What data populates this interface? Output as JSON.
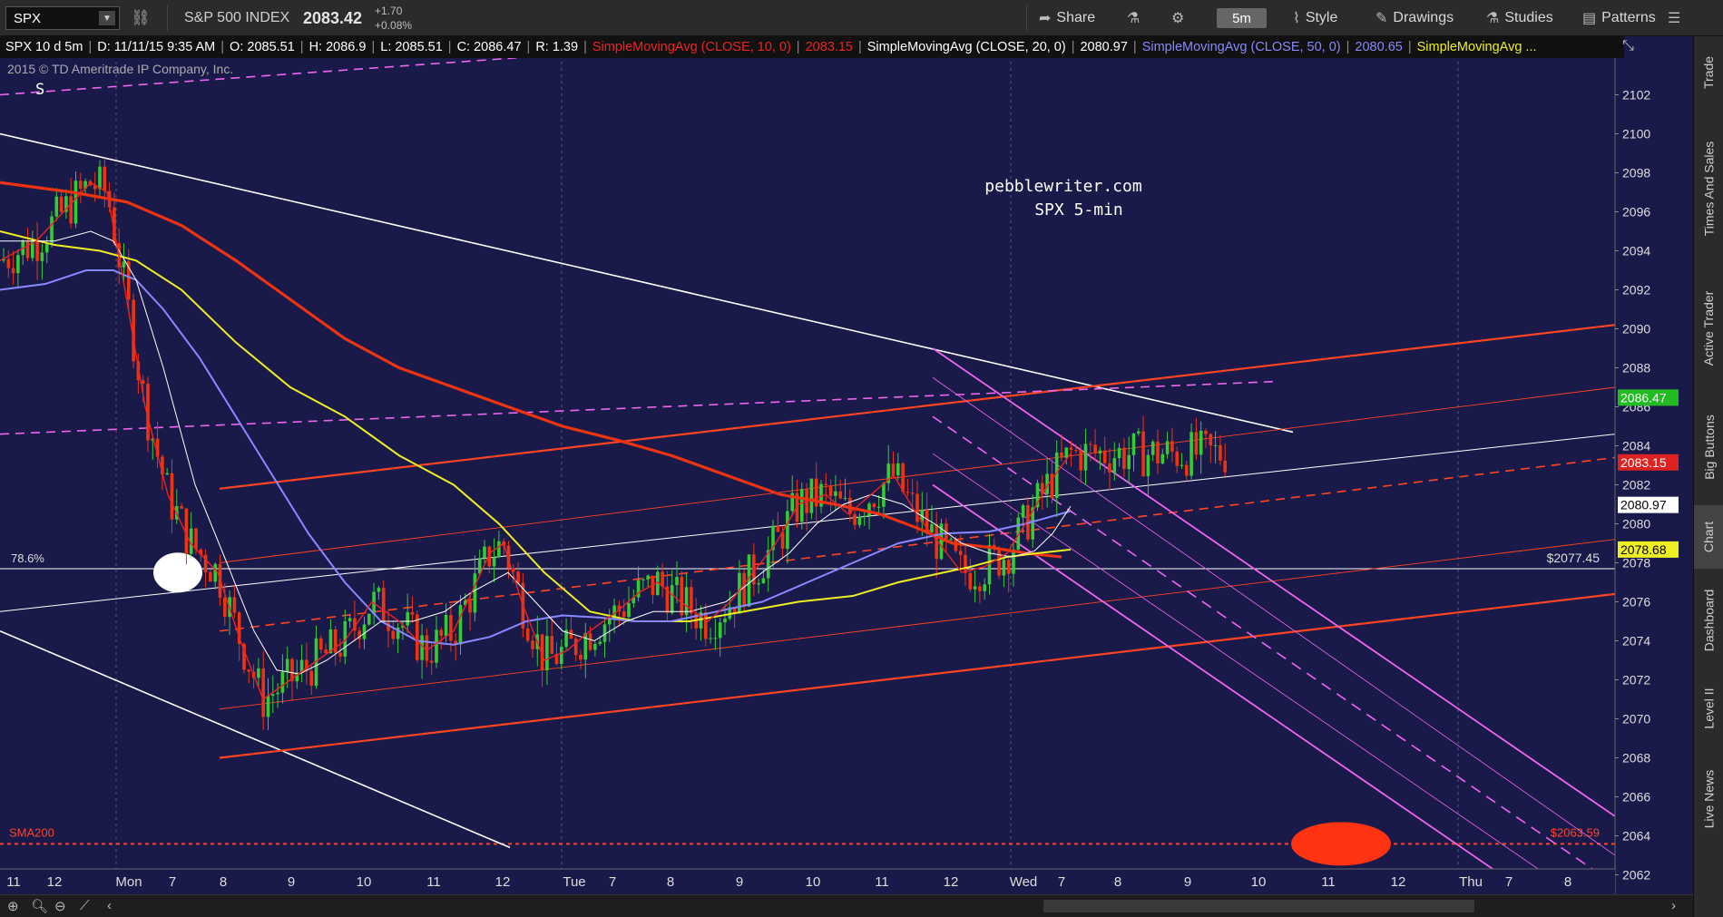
{
  "toolbar": {
    "symbol": "SPX",
    "index_name": "S&P 500 INDEX",
    "last_price": "2083.42",
    "change": "+1.70",
    "change_pct": "+0.08%",
    "share": "Share",
    "timeframe": "5m",
    "style": "Style",
    "drawings": "Drawings",
    "studies": "Studies",
    "patterns": "Patterns"
  },
  "header": {
    "instrument": "SPX 10 d 5m",
    "date": "D: 11/11/15 9:35 AM",
    "open": "O: 2085.51",
    "high": "H: 2086.9",
    "low": "L: 2085.51",
    "close": "C: 2086.47",
    "range": "R: 1.39",
    "sma10_label": "SimpleMovingAvg (CLOSE, 10, 0)",
    "sma10_value": "2083.15",
    "sma20_label": "SimpleMovingAvg (CLOSE, 20, 0)",
    "sma20_value": "2080.97",
    "sma50_label": "SimpleMovingAvg (CLOSE, 50, 0)",
    "sma50_value": "2080.65",
    "sma_more_label": "SimpleMovingAvg ...",
    "copyright": "2015 © TD Ameritrade IP Company, Inc."
  },
  "sidebar": {
    "tabs": [
      "Trade",
      "Times And Sales",
      "Active Trader",
      "Big Buttons",
      "Chart",
      "Dashboard",
      "Level II",
      "Live News"
    ]
  },
  "colors": {
    "background": "#1a1a4a",
    "up": "#33cc33",
    "down": "#ee3311",
    "sma10": "#ee2222",
    "sma20": "#ffffff",
    "sma50": "#8888ff",
    "sma_yellow": "#eeee22",
    "sma200": "#ee3311",
    "channel_orange": "#ff5522",
    "pink": "#ee66ee"
  },
  "chart_data": {
    "type": "candlestick",
    "title": "pebblewriter.com",
    "subtitle": "SPX 5-min",
    "ylim": [
      2061,
      2105
    ],
    "yticks": [
      2062,
      2064,
      2066,
      2068,
      2070,
      2072,
      2074,
      2076,
      2078,
      2080,
      2082,
      2084,
      2086,
      2088,
      2090,
      2092,
      2094,
      2096,
      2098,
      2100,
      2102
    ],
    "x_labels": [
      "11",
      "12",
      "Mon",
      "7",
      "8",
      "9",
      "10",
      "11",
      "12",
      "Tue",
      "7",
      "8",
      "9",
      "10",
      "11",
      "12",
      "Wed",
      "7",
      "8",
      "9",
      "10",
      "11",
      "12",
      "Thu",
      "7",
      "8"
    ],
    "x_label_days": [
      false,
      false,
      true,
      false,
      false,
      false,
      false,
      false,
      false,
      true,
      false,
      false,
      false,
      false,
      false,
      false,
      true,
      false,
      false,
      false,
      false,
      false,
      false,
      true,
      false,
      false
    ],
    "price_labels": [
      {
        "value": 2086.47,
        "text": "2086.47",
        "color": "#22bb22",
        "textcolor": "#ffffff"
      },
      {
        "value": 2083.15,
        "text": "2083.15",
        "color": "#dd2222",
        "textcolor": "#ffffff"
      },
      {
        "value": 2080.97,
        "text": "2080.97",
        "color": "#ffffff",
        "textcolor": "#000000"
      },
      {
        "value": 2078.68,
        "text": "2078.68",
        "color": "#eeee22",
        "textcolor": "#000000"
      }
    ],
    "annotations": {
      "s_marker": "S",
      "fib_label": "78.6%",
      "fib_value": 2077.7,
      "fib_price": "$2077.45",
      "sma200_label": "SMA200",
      "sma200_value": 2063.59,
      "sma200_price": "$2063.59"
    },
    "sma10": [
      [
        0,
        2093.5
      ],
      [
        40,
        2094.5
      ],
      [
        80,
        2096.5
      ],
      [
        100,
        2097.5
      ],
      [
        118,
        2097.0
      ],
      [
        134,
        2093.0
      ],
      [
        160,
        2086.0
      ],
      [
        185,
        2081.5
      ],
      [
        210,
        2079.0
      ],
      [
        240,
        2077.5
      ],
      [
        265,
        2074.0
      ],
      [
        290,
        2071.0
      ],
      [
        320,
        2072.0
      ],
      [
        350,
        2073.0
      ],
      [
        380,
        2074.0
      ],
      [
        410,
        2076.0
      ],
      [
        440,
        2075.0
      ],
      [
        470,
        2073.5
      ],
      [
        500,
        2074.5
      ],
      [
        520,
        2076.5
      ],
      [
        540,
        2078.5
      ],
      [
        555,
        2079.0
      ],
      [
        575,
        2076.0
      ],
      [
        600,
        2073.0
      ],
      [
        625,
        2073.5
      ],
      [
        650,
        2074.5
      ],
      [
        680,
        2075.5
      ],
      [
        705,
        2076.5
      ],
      [
        725,
        2077.0
      ],
      [
        750,
        2076.0
      ],
      [
        780,
        2075.0
      ],
      [
        805,
        2076.0
      ],
      [
        830,
        2077.5
      ],
      [
        855,
        2079.0
      ],
      [
        880,
        2081.0
      ],
      [
        910,
        2081.5
      ],
      [
        935,
        2080.5
      ],
      [
        960,
        2081.5
      ],
      [
        985,
        2082.5
      ],
      [
        1010,
        2080.5
      ],
      [
        1035,
        2079.0
      ],
      [
        1060,
        2077.5
      ],
      [
        1085,
        2077.8
      ],
      [
        1110,
        2078.5
      ],
      [
        1130,
        2080.0
      ],
      [
        1155,
        2082.0
      ],
      [
        1180,
        2083.6
      ]
    ],
    "sma20": [
      [
        0,
        2094.5
      ],
      [
        60,
        2094.5
      ],
      [
        100,
        2095.0
      ],
      [
        125,
        2094.5
      ],
      [
        150,
        2092.5
      ],
      [
        180,
        2088.0
      ],
      [
        215,
        2082.0
      ],
      [
        250,
        2078.0
      ],
      [
        280,
        2074.5
      ],
      [
        305,
        2072.5
      ],
      [
        330,
        2072.3
      ],
      [
        360,
        2073.0
      ],
      [
        390,
        2074.0
      ],
      [
        420,
        2075.0
      ],
      [
        455,
        2075.0
      ],
      [
        490,
        2075.5
      ],
      [
        520,
        2076.5
      ],
      [
        560,
        2077.5
      ],
      [
        590,
        2076.0
      ],
      [
        620,
        2074.5
      ],
      [
        655,
        2074.0
      ],
      [
        690,
        2075.0
      ],
      [
        720,
        2075.5
      ],
      [
        760,
        2075.5
      ],
      [
        800,
        2076.0
      ],
      [
        840,
        2077.5
      ],
      [
        870,
        2078.5
      ],
      [
        900,
        2080.0
      ],
      [
        930,
        2081.0
      ],
      [
        960,
        2081.5
      ],
      [
        995,
        2081.0
      ],
      [
        1030,
        2080.0
      ],
      [
        1060,
        2079.0
      ],
      [
        1090,
        2078.5
      ],
      [
        1115,
        2078.3
      ],
      [
        1140,
        2078.6
      ],
      [
        1160,
        2079.5
      ],
      [
        1180,
        2080.9
      ]
    ],
    "sma50": [
      [
        0,
        2092.0
      ],
      [
        50,
        2092.3
      ],
      [
        95,
        2093.0
      ],
      [
        125,
        2093.0
      ],
      [
        150,
        2092.5
      ],
      [
        180,
        2091.0
      ],
      [
        220,
        2088.5
      ],
      [
        260,
        2085.5
      ],
      [
        300,
        2082.5
      ],
      [
        340,
        2079.5
      ],
      [
        380,
        2077.0
      ],
      [
        420,
        2075.0
      ],
      [
        460,
        2074.0
      ],
      [
        500,
        2073.8
      ],
      [
        540,
        2074.2
      ],
      [
        580,
        2075.0
      ],
      [
        620,
        2075.3
      ],
      [
        660,
        2075.2
      ],
      [
        700,
        2075.0
      ],
      [
        740,
        2075.0
      ],
      [
        790,
        2075.5
      ],
      [
        840,
        2076.0
      ],
      [
        890,
        2077.0
      ],
      [
        940,
        2078.0
      ],
      [
        990,
        2079.0
      ],
      [
        1040,
        2079.5
      ],
      [
        1090,
        2079.6
      ],
      [
        1130,
        2080.0
      ],
      [
        1180,
        2080.65
      ]
    ],
    "sma_yellow": [
      [
        0,
        2095.0
      ],
      [
        60,
        2094.3
      ],
      [
        110,
        2094.0
      ],
      [
        150,
        2093.5
      ],
      [
        200,
        2092.0
      ],
      [
        260,
        2089.3
      ],
      [
        320,
        2087.0
      ],
      [
        380,
        2085.5
      ],
      [
        440,
        2083.5
      ],
      [
        500,
        2082.0
      ],
      [
        550,
        2080.0
      ],
      [
        600,
        2077.5
      ],
      [
        650,
        2075.5
      ],
      [
        700,
        2075.0
      ],
      [
        760,
        2075.0
      ],
      [
        820,
        2075.5
      ],
      [
        880,
        2076.0
      ],
      [
        940,
        2076.3
      ],
      [
        990,
        2077.0
      ],
      [
        1030,
        2077.4
      ],
      [
        1070,
        2077.8
      ],
      [
        1110,
        2078.3
      ],
      [
        1145,
        2078.5
      ],
      [
        1180,
        2078.68
      ]
    ],
    "sma200": [
      [
        0,
        2097.5
      ],
      [
        80,
        2097.0
      ],
      [
        140,
        2096.5
      ],
      [
        200,
        2095.3
      ],
      [
        260,
        2093.5
      ],
      [
        320,
        2091.5
      ],
      [
        380,
        2089.5
      ],
      [
        440,
        2088.0
      ],
      [
        500,
        2087.0
      ],
      [
        560,
        2086.0
      ],
      [
        620,
        2085.0
      ],
      [
        680,
        2084.3
      ],
      [
        740,
        2083.5
      ],
      [
        800,
        2082.5
      ],
      [
        860,
        2081.5
      ],
      [
        920,
        2081.0
      ],
      [
        970,
        2080.5
      ],
      [
        1010,
        2079.8
      ],
      [
        1050,
        2079.0
      ],
      [
        1090,
        2078.8
      ],
      [
        1130,
        2078.5
      ],
      [
        1170,
        2078.3
      ]
    ]
  }
}
